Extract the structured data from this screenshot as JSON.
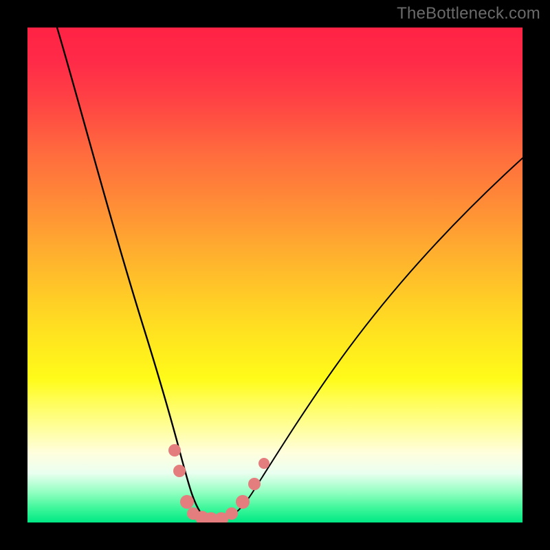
{
  "watermark": {
    "text": "TheBottleneck.com"
  },
  "chart_data": {
    "type": "line",
    "title": "",
    "xlabel": "",
    "ylabel": "",
    "xlim": [
      0,
      100
    ],
    "ylim": [
      0,
      100
    ],
    "grid": false,
    "legend": false,
    "annotations": [],
    "series": [
      {
        "name": "bottleneck-curve",
        "x": [
          6,
          10,
          14,
          18,
          22,
          26,
          28,
          30,
          32,
          33.5,
          35,
          37,
          39,
          42,
          46,
          52,
          58,
          66,
          74,
          82,
          90,
          100
        ],
        "y": [
          100,
          87,
          73,
          60,
          47,
          30,
          20,
          12,
          6,
          3,
          1.5,
          0.7,
          0.7,
          2.5,
          7,
          16,
          26,
          38,
          49,
          58,
          66,
          74
        ]
      }
    ],
    "markers": [
      {
        "x": 29.6,
        "y": 14.6
      },
      {
        "x": 30.6,
        "y": 10.4
      },
      {
        "x": 32.2,
        "y": 4.2
      },
      {
        "x": 33.5,
        "y": 1.9
      },
      {
        "x": 35.3,
        "y": 1.0
      },
      {
        "x": 37.0,
        "y": 0.7
      },
      {
        "x": 39.2,
        "y": 0.7
      },
      {
        "x": 41.2,
        "y": 1.9
      },
      {
        "x": 43.5,
        "y": 4.2
      },
      {
        "x": 45.8,
        "y": 7.8
      },
      {
        "x": 47.8,
        "y": 12.0
      }
    ],
    "background_gradient": {
      "top_color": "#ff2244",
      "mid_color": "#ffe61f",
      "bottom_color": "#00e884"
    }
  }
}
